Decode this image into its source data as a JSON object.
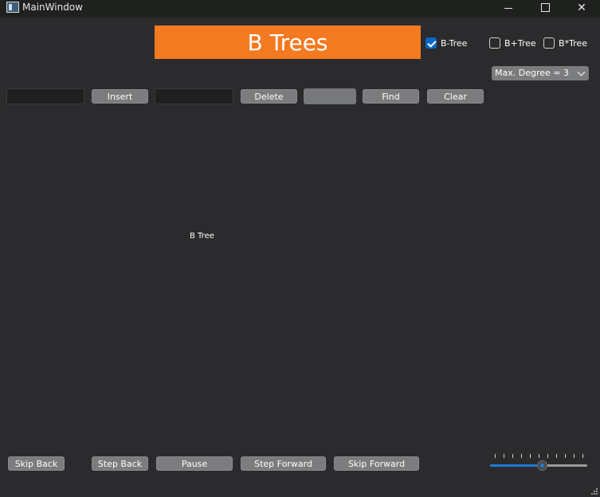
{
  "window": {
    "title": "MainWindow",
    "controls": {
      "minimize": "minimize-icon",
      "maximize": "maximize-icon",
      "close": "✕"
    }
  },
  "header": {
    "title": "B Trees",
    "tree_types": [
      {
        "label": "B-Tree",
        "checked": true
      },
      {
        "label": "B+Tree",
        "checked": false
      },
      {
        "label": "B*Tree",
        "checked": false
      }
    ],
    "degree_select": {
      "value": "Max. Degree = 3"
    }
  },
  "toolbar": {
    "insert_value": "",
    "insert_label": "Insert",
    "delete_value": "",
    "delete_label": "Delete",
    "find_value": "",
    "find_label": "Find",
    "clear_label": "Clear"
  },
  "canvas": {
    "label": "B Tree"
  },
  "playback": {
    "skip_back": "Skip Back",
    "step_back": "Step Back",
    "pause": "Pause",
    "step_forward": "Step Forward",
    "skip_forward": "Skip Forward",
    "speed": {
      "value": 0.53
    }
  },
  "colors": {
    "accent": "#f47a21",
    "background": "#2b2b2d",
    "button": "#7b7c7e",
    "selection": "#0a67c7"
  }
}
